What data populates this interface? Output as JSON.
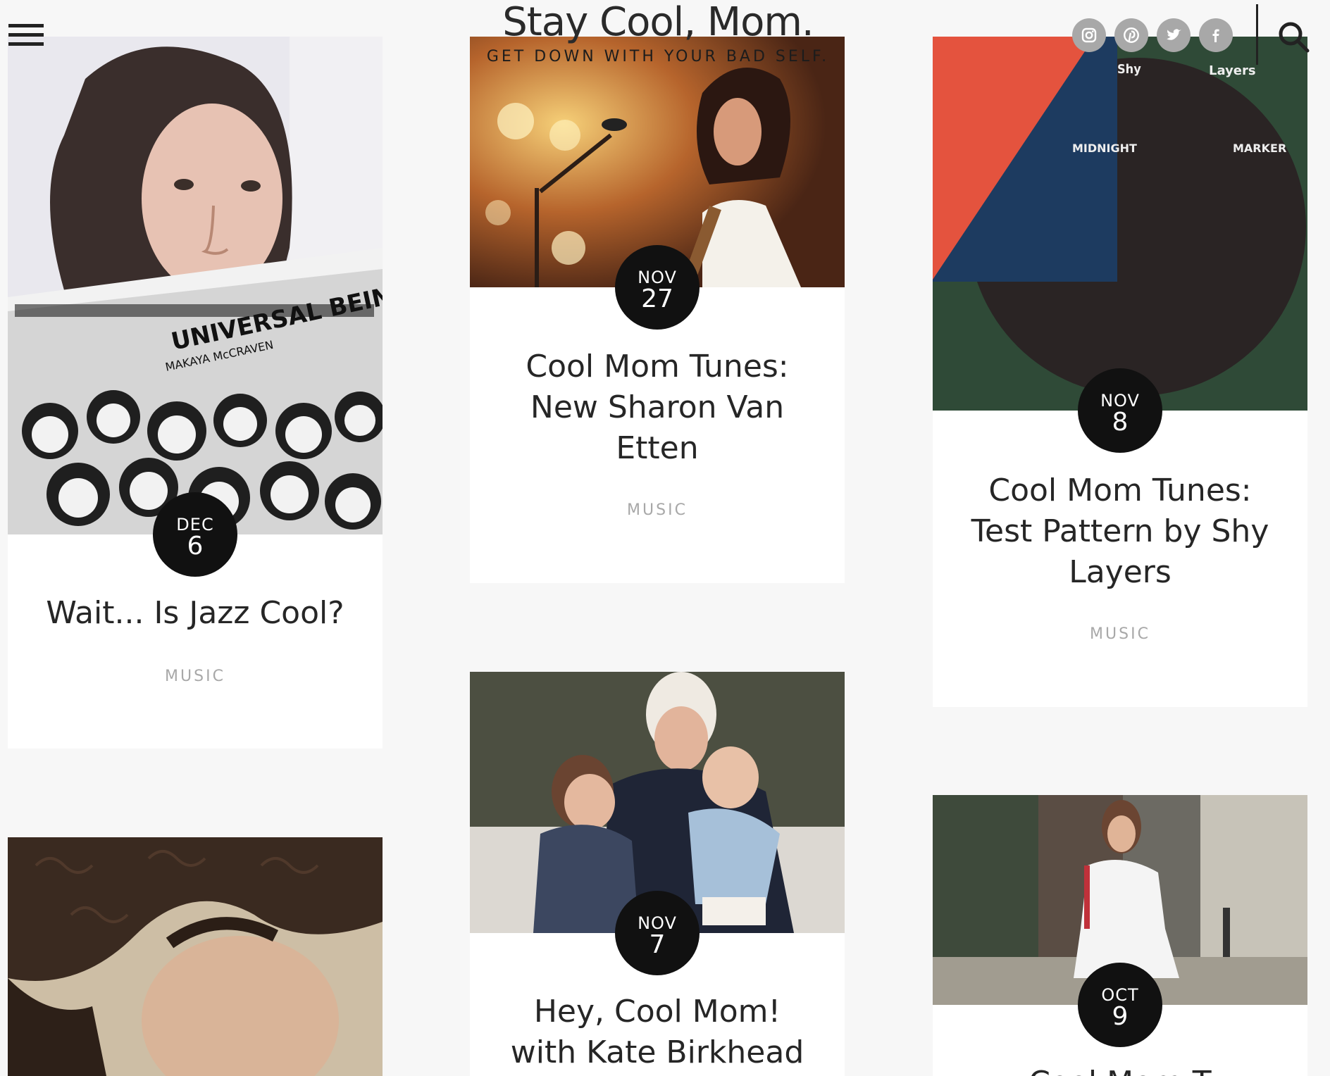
{
  "header": {
    "menu_icon": "hamburger-menu-icon",
    "site_title": "Stay Cool, Mom.",
    "tagline": "GET DOWN WITH YOUR BAD SELF.",
    "social": [
      {
        "name": "instagram-icon"
      },
      {
        "name": "pinterest-icon"
      },
      {
        "name": "twitter-icon"
      },
      {
        "name": "facebook-icon"
      }
    ],
    "search_icon": "search-icon"
  },
  "cards": [
    {
      "month": "DEC",
      "day": "6",
      "title": "Wait... Is Jazz Cool?",
      "category": "MUSIC",
      "album_title": "UNIVERSAL BEINGS",
      "album_artist": "MAKAYA McCRAVEN"
    },
    {
      "month": "NOV",
      "day": "27",
      "title": "Cool Mom Tunes: New Sharon Van Etten",
      "category": "MUSIC"
    },
    {
      "month": "NOV",
      "day": "8",
      "title": "Cool Mom Tunes: Test Pattern by Shy Layers",
      "category": "MUSIC",
      "album_words": [
        "Shy",
        "Layers",
        "MIDNIGHT",
        "MARKER"
      ]
    },
    {
      "month": "NOV",
      "day": "7",
      "title": "Hey, Cool Mom! with Kate Birkhead"
    },
    {
      "month": "OCT",
      "day": "9",
      "title": "Cool Mom T"
    },
    {
      "image": "curly-hair-portrait"
    }
  ],
  "colors": {
    "background": "#f7f7f7",
    "badge": "#111111",
    "category": "#a8a8a8",
    "social": "#a8a8a8"
  }
}
